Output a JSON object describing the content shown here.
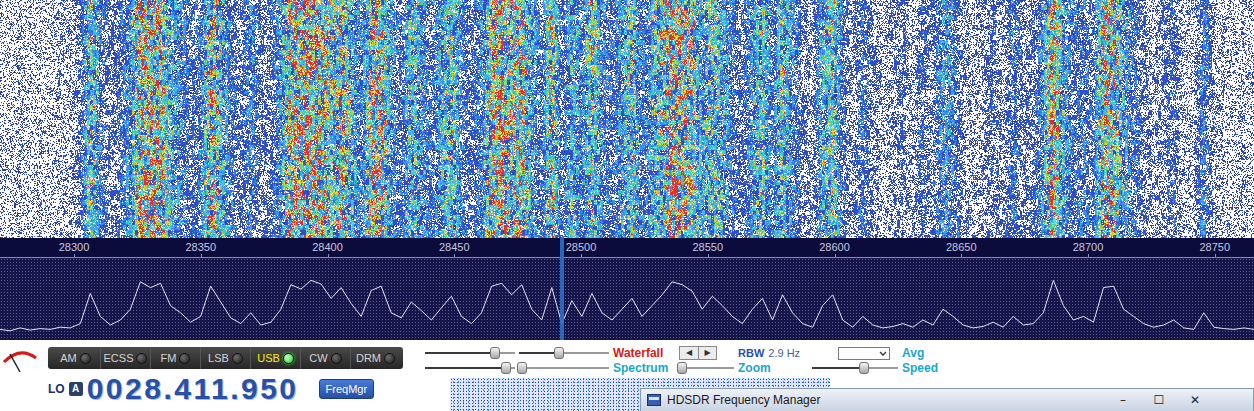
{
  "axis": {
    "ticks": [
      "28300",
      "28350",
      "28400",
      "28450",
      "28500",
      "28550",
      "28600",
      "28650",
      "28700",
      "28750"
    ]
  },
  "spectrum": {
    "values": [
      12,
      10,
      14,
      11,
      13,
      12,
      15,
      14,
      20,
      62,
      30,
      18,
      25,
      40,
      78,
      70,
      76,
      45,
      35,
      22,
      30,
      72,
      50,
      28,
      20,
      35,
      18,
      22,
      40,
      74,
      68,
      80,
      75,
      55,
      70,
      48,
      30,
      66,
      72,
      35,
      28,
      50,
      38,
      25,
      42,
      58,
      30,
      20,
      35,
      72,
      76,
      60,
      74,
      40,
      25,
      70,
      20,
      52,
      30,
      62,
      35,
      25,
      40,
      55,
      30,
      45,
      60,
      78,
      74,
      65,
      40,
      58,
      45,
      30,
      20,
      40,
      55,
      25,
      60,
      35,
      20,
      15,
      45,
      60,
      25,
      15,
      30,
      18,
      14,
      16,
      20,
      15,
      25,
      18,
      40,
      30,
      18,
      14,
      16,
      22,
      15,
      30,
      18,
      20,
      35,
      80,
      45,
      25,
      30,
      22,
      70,
      72,
      40,
      30,
      20,
      15,
      18,
      25,
      14,
      12,
      35,
      15,
      13,
      12,
      14,
      12
    ],
    "marker": {
      "level": 0.448
    }
  },
  "modes": [
    {
      "label": "AM",
      "selected": false
    },
    {
      "label": "ECSS",
      "selected": false
    },
    {
      "label": "FM",
      "selected": false
    },
    {
      "label": "LSB",
      "selected": false
    },
    {
      "label": "USB",
      "selected": true
    },
    {
      "label": "CW",
      "selected": false
    },
    {
      "label": "DRM",
      "selected": false
    }
  ],
  "lo": {
    "label": "LO",
    "bank": "A",
    "frequency": "0028.411.950"
  },
  "freqmgr_button": "FreqMgr",
  "waterfall_controls": {
    "label": "Waterfall",
    "sliders": [
      {
        "level": 0.78
      },
      {
        "level": 0.44
      }
    ],
    "buttons": [
      "◀",
      "▶"
    ]
  },
  "spectrum_controls": {
    "label": "Spectrum",
    "sliders": [
      {
        "level": 0.9
      },
      {
        "level": 0.03
      }
    ]
  },
  "rbw": {
    "label": "RBW",
    "value": "2.9 Hz"
  },
  "zoom": {
    "label": "Zoom",
    "level": 0.06
  },
  "avg": {
    "label": "Avg"
  },
  "speed": {
    "label": "Speed",
    "level": 0.6
  },
  "freq_manager_window": {
    "title": "HDSDR Frequency Manager",
    "buttons": [
      "–",
      "☐",
      "✕"
    ]
  }
}
